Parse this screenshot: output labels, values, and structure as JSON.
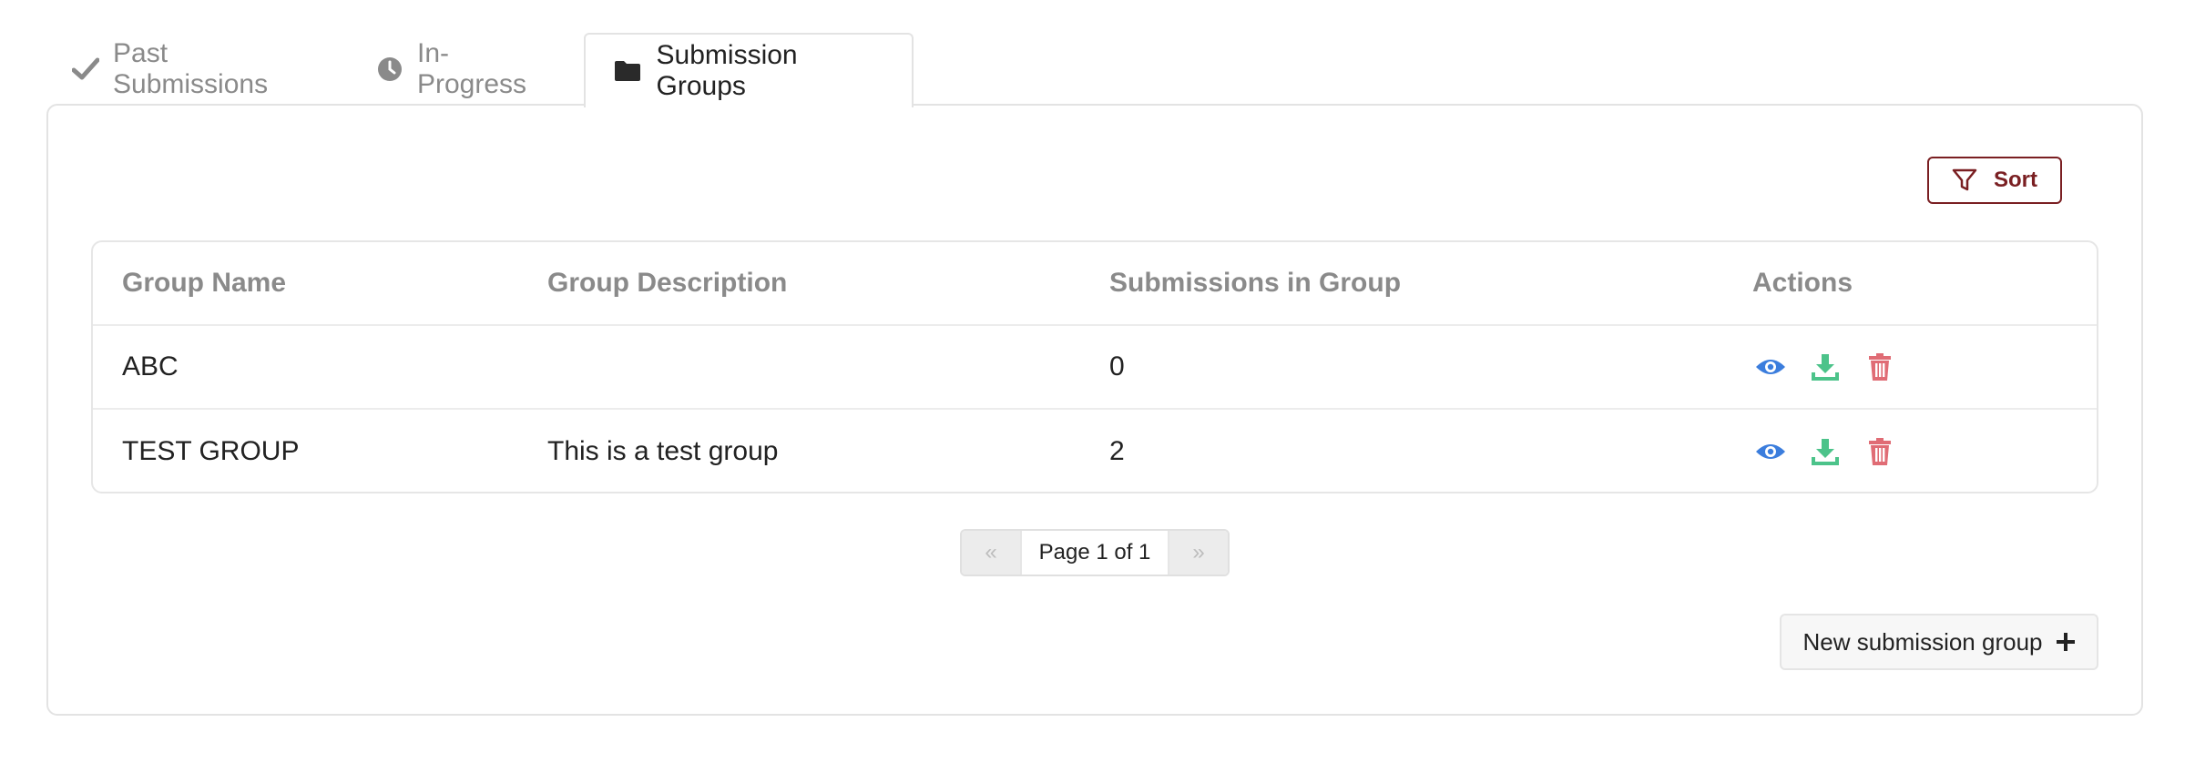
{
  "tabs": [
    {
      "label": "Past Submissions",
      "icon": "check-icon",
      "active": false
    },
    {
      "label": "In-Progress",
      "icon": "clock-icon",
      "active": false
    },
    {
      "label": "Submission Groups",
      "icon": "folder-icon",
      "active": true
    }
  ],
  "toolbar": {
    "sort_label": "Sort"
  },
  "table": {
    "columns": [
      "Group Name",
      "Group Description",
      "Submissions in Group",
      "Actions"
    ],
    "rows": [
      {
        "name": "ABC",
        "description": "",
        "count": "0"
      },
      {
        "name": "TEST GROUP",
        "description": "This is a test group",
        "count": "2"
      }
    ]
  },
  "pagination": {
    "prev": "«",
    "label": "Page 1 of 1",
    "next": "»"
  },
  "footer": {
    "new_group_label": "New submission group"
  },
  "colors": {
    "accent": "#7a1f22",
    "view": "#3b7ddd",
    "download": "#4cc38a",
    "delete": "#e06c75"
  }
}
